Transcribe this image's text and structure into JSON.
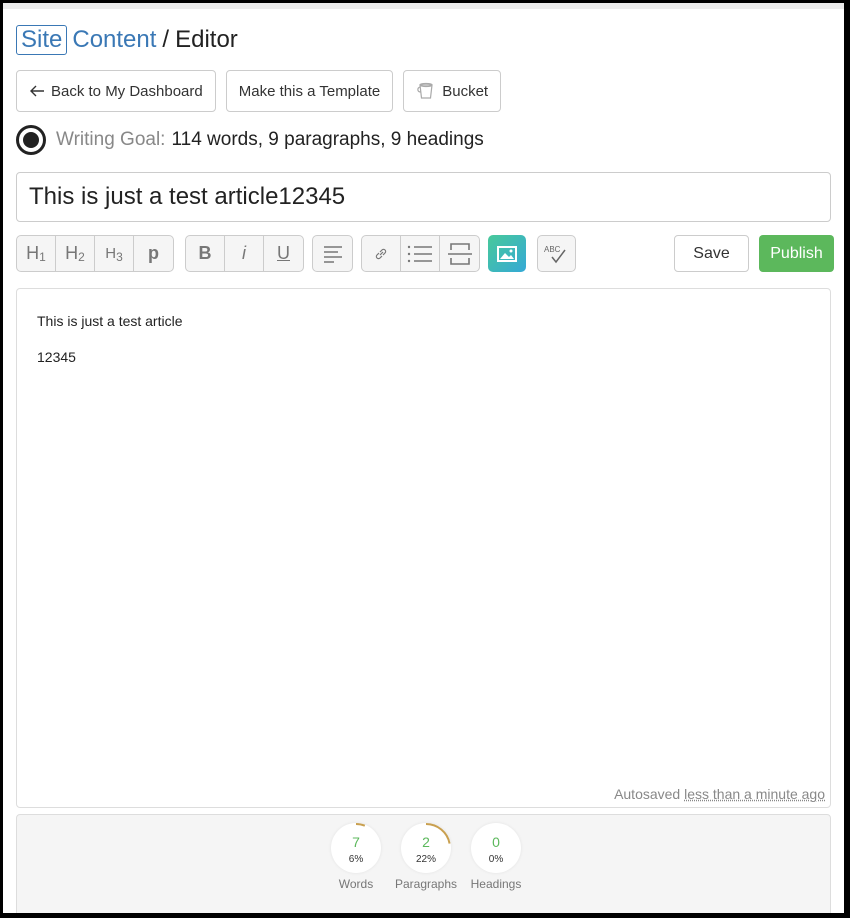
{
  "breadcrumb": {
    "site": "Site",
    "content": "Content",
    "separator": "/",
    "current": "Editor"
  },
  "actions": {
    "back": "Back to My Dashboard",
    "template": "Make this a Template",
    "bucket": "Bucket"
  },
  "goal": {
    "label": "Writing Goal:",
    "value": "114 words, 9 paragraphs, 9 headings"
  },
  "title": {
    "value": "This is just a test article12345"
  },
  "toolbar": {
    "h1": "H",
    "h2": "H",
    "h3": "H",
    "p": "p",
    "bold": "B",
    "italic": "i",
    "underline": "U",
    "sub1": "1",
    "sub2": "2",
    "sub3": "3",
    "spellcheck_text": "ABC",
    "save": "Save",
    "publish": "Publish"
  },
  "editor": {
    "paragraphs": [
      "This is just a test article",
      "12345"
    ],
    "autosave_label": "Autosaved",
    "autosave_when": "less than a minute ago"
  },
  "stats": [
    {
      "value": "7",
      "percent": "6%",
      "fraction": 0.06,
      "label": "Words"
    },
    {
      "value": "2",
      "percent": "22%",
      "fraction": 0.22,
      "label": "Paragraphs"
    },
    {
      "value": "0",
      "percent": "0%",
      "fraction": 0.0,
      "label": "Headings"
    }
  ],
  "colors": {
    "accent": "#3a78b5",
    "publish": "#5cb85c",
    "progress": "#c9a050",
    "stat_value": "#5cb85c"
  }
}
